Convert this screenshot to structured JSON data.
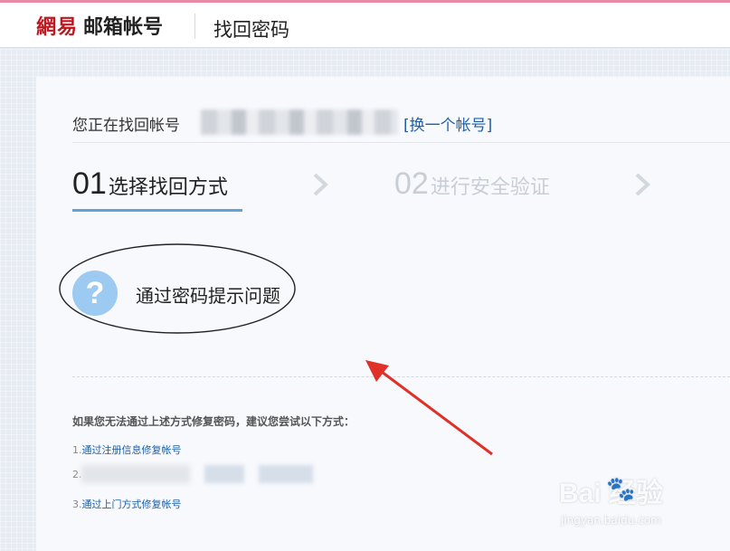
{
  "header": {
    "brand": "網易",
    "product": "邮箱帐号",
    "title": "找回密码"
  },
  "account": {
    "prefix": "您正在找回帐号",
    "switch_link": "[换一个帐号]"
  },
  "steps": [
    {
      "number": "01",
      "label": "选择找回方式"
    },
    {
      "number": "02",
      "label": "进行安全验证"
    }
  ],
  "option": {
    "icon": "question-icon",
    "icon_glyph": "?",
    "label": "通过密码提示问题"
  },
  "alternatives": {
    "heading": "如果您无法通过上述方式修复密码，建议您尝试以下方式：",
    "items": [
      {
        "index": "1.",
        "label": "通过注册信息修复帐号"
      },
      {
        "index": "2.",
        "label": ""
      },
      {
        "index": "3.",
        "label": "通过上门方式修复帐号"
      }
    ]
  },
  "watermark": {
    "brand": "Bai  经验",
    "url": "jingyan.baidu.com"
  },
  "colors": {
    "brand_red": "#c0161d",
    "link_blue": "#1f5fa8",
    "step_active_underline": "#5fa3d9",
    "annotation_red": "#e0302a"
  }
}
